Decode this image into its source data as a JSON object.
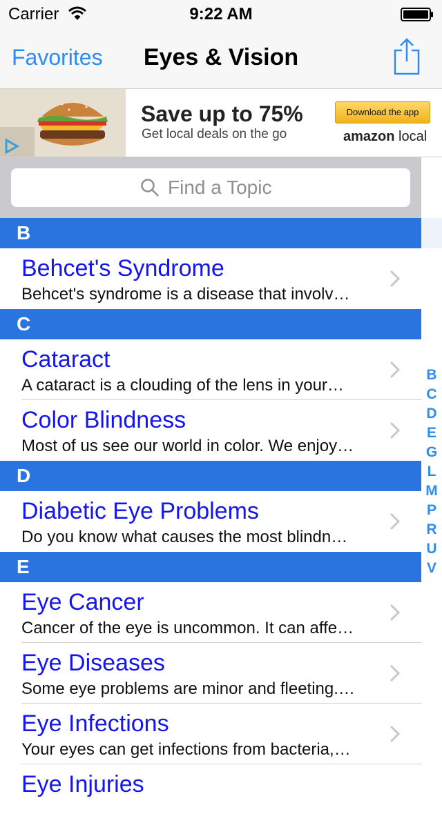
{
  "status_bar": {
    "carrier": "Carrier",
    "time": "9:22 AM"
  },
  "nav": {
    "back_label": "Favorites",
    "title": "Eyes & Vision"
  },
  "ad": {
    "headline": "Save up to 75%",
    "subline": "Get local deals on the go",
    "cta": "Download the app",
    "brand_bold": "amazon",
    "brand_light": "local"
  },
  "search": {
    "placeholder": "Find a Topic",
    "value": ""
  },
  "sections": [
    {
      "letter": "B",
      "rows": [
        {
          "title": "Behcet's Syndrome",
          "desc": "Behcet's syndrome is a disease that involv…"
        }
      ]
    },
    {
      "letter": "C",
      "rows": [
        {
          "title": "Cataract",
          "desc": "A cataract is a clouding of the lens in your…"
        },
        {
          "title": "Color Blindness",
          "desc": "Most of us see our world in color. We enjoy…"
        }
      ]
    },
    {
      "letter": "D",
      "rows": [
        {
          "title": "Diabetic Eye Problems",
          "desc": "Do you know what causes the most blindn…"
        }
      ]
    },
    {
      "letter": "E",
      "rows": [
        {
          "title": "Eye Cancer",
          "desc": "Cancer of the eye is uncommon. It can affe…"
        },
        {
          "title": "Eye Diseases",
          "desc": "Some eye problems are minor and fleeting.…"
        },
        {
          "title": "Eye Infections",
          "desc": "Your eyes can get infections from bacteria,…"
        },
        {
          "title": "Eye Injuries",
          "desc": ""
        }
      ]
    }
  ],
  "index_letters": [
    "B",
    "C",
    "D",
    "E",
    "G",
    "L",
    "M",
    "P",
    "R",
    "U",
    "V"
  ],
  "colors": {
    "accent": "#2e8cf0",
    "section_header": "#2a74e0",
    "row_title": "#1515ee"
  },
  "icons": {
    "share": "share-icon",
    "search": "search-icon",
    "chevron": "chevron-right-icon",
    "wifi": "wifi-icon",
    "battery": "battery-icon"
  }
}
